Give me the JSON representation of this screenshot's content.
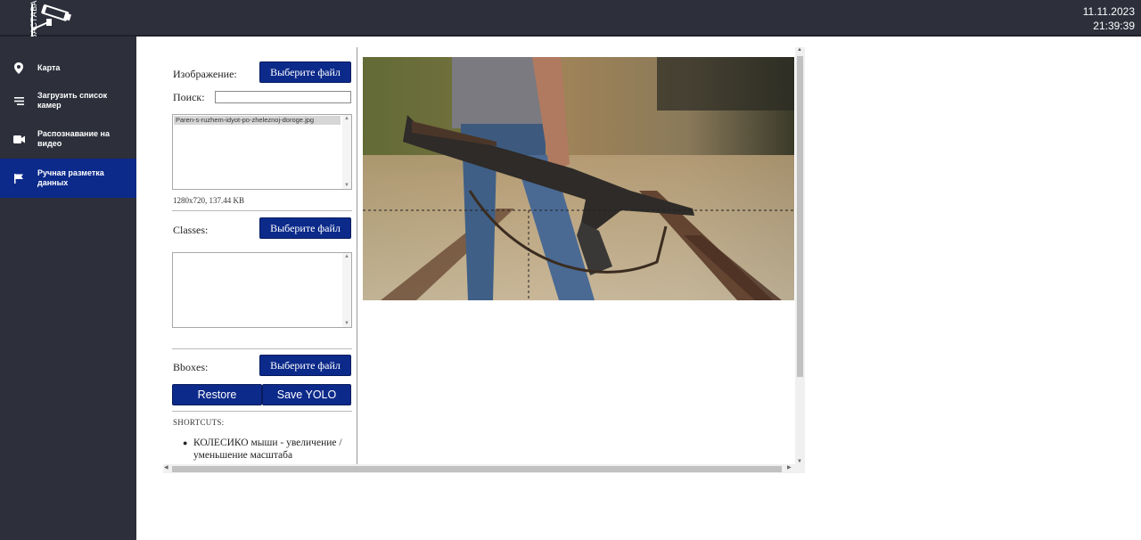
{
  "app": {
    "logo_text": "ЗАСТАВА",
    "date": "11.11.2023",
    "time": "21:39:39"
  },
  "sidebar": {
    "items": [
      {
        "label": "Карта",
        "icon": "map-pin-icon",
        "active": false
      },
      {
        "label": "Загрузить список камер",
        "icon": "list-icon",
        "active": false
      },
      {
        "label": "Распознавание на видео",
        "icon": "video-icon",
        "active": false
      },
      {
        "label": "Ручная разметка данных",
        "icon": "flag-icon",
        "active": true
      }
    ]
  },
  "image_section": {
    "label": "Изображение:",
    "choose_file": "Выберите файл",
    "search_label": "Поиск:",
    "search_value": "",
    "files": [
      "Paren-s-ruzhem-idyot-po-zheleznoj-doroge.jpg"
    ],
    "meta": "1280x720, 137.44 KB"
  },
  "classes_section": {
    "label": "Classes:",
    "choose_file": "Выберите файл"
  },
  "bboxes_section": {
    "label": "Bboxes:",
    "choose_file": "Выберите файл",
    "restore": "Restore",
    "save_yolo": "Save YOLO"
  },
  "shortcuts": {
    "title": "SHORTCUTS:",
    "items": [
      "КОЛЕСИКО мыши - увеличение / уменьшение масштаба"
    ]
  },
  "colors": {
    "sidebar_bg": "#2d2f3b",
    "accent": "#0c2a8a"
  }
}
